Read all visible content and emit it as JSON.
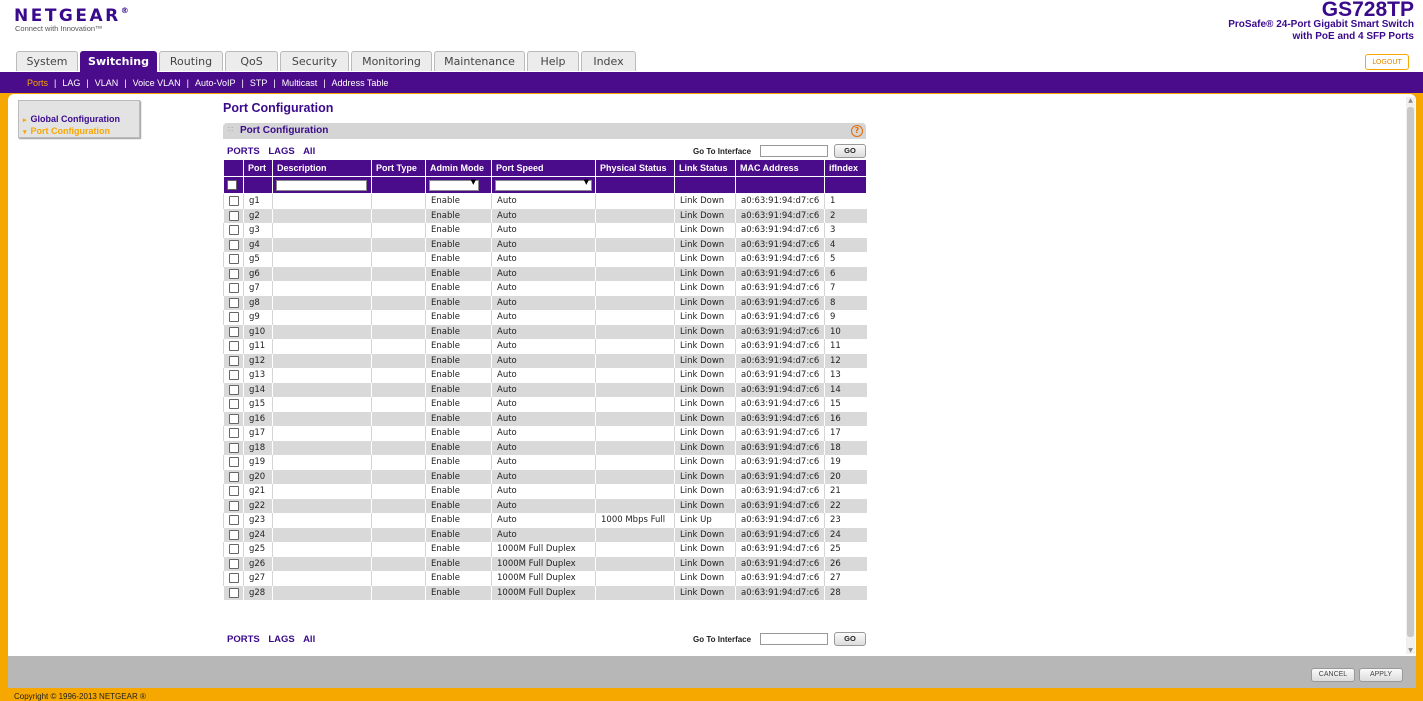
{
  "header": {
    "logo": "NETGEAR",
    "tagline": "Connect with Innovation™",
    "model": "GS728TP",
    "model_desc_line1": "ProSafe® 24-Port Gigabit Smart Switch",
    "model_desc_line2": "with PoE and 4 SFP Ports",
    "logout": "LOGOUT"
  },
  "tabs": [
    "System",
    "Switching",
    "Routing",
    "QoS",
    "Security",
    "Monitoring",
    "Maintenance",
    "Help",
    "Index"
  ],
  "active_tab": "Switching",
  "subnav": [
    "Ports",
    "LAG",
    "VLAN",
    "Voice VLAN",
    "Auto-VoIP",
    "STP",
    "Multicast",
    "Address Table"
  ],
  "active_subnav": "Ports",
  "leftnav": [
    "Global Configuration",
    "Port Configuration"
  ],
  "page_title": "Port Configuration",
  "panel_title": "Port Configuration",
  "help_icon": "?",
  "filter_links": [
    "PORTS",
    "LAGS",
    "All"
  ],
  "goto_label": "Go To Interface",
  "go_button": "GO",
  "table": {
    "columns": [
      "",
      "Port",
      "Description",
      "Port Type",
      "Admin Mode",
      "Port Speed",
      "Physical Status",
      "Link Status",
      "MAC Address",
      "ifIndex"
    ],
    "rows": [
      [
        "g1",
        "",
        "",
        "Enable",
        "Auto",
        "",
        "Link Down",
        "a0:63:91:94:d7:c6",
        "1"
      ],
      [
        "g2",
        "",
        "",
        "Enable",
        "Auto",
        "",
        "Link Down",
        "a0:63:91:94:d7:c6",
        "2"
      ],
      [
        "g3",
        "",
        "",
        "Enable",
        "Auto",
        "",
        "Link Down",
        "a0:63:91:94:d7:c6",
        "3"
      ],
      [
        "g4",
        "",
        "",
        "Enable",
        "Auto",
        "",
        "Link Down",
        "a0:63:91:94:d7:c6",
        "4"
      ],
      [
        "g5",
        "",
        "",
        "Enable",
        "Auto",
        "",
        "Link Down",
        "a0:63:91:94:d7:c6",
        "5"
      ],
      [
        "g6",
        "",
        "",
        "Enable",
        "Auto",
        "",
        "Link Down",
        "a0:63:91:94:d7:c6",
        "6"
      ],
      [
        "g7",
        "",
        "",
        "Enable",
        "Auto",
        "",
        "Link Down",
        "a0:63:91:94:d7:c6",
        "7"
      ],
      [
        "g8",
        "",
        "",
        "Enable",
        "Auto",
        "",
        "Link Down",
        "a0:63:91:94:d7:c6",
        "8"
      ],
      [
        "g9",
        "",
        "",
        "Enable",
        "Auto",
        "",
        "Link Down",
        "a0:63:91:94:d7:c6",
        "9"
      ],
      [
        "g10",
        "",
        "",
        "Enable",
        "Auto",
        "",
        "Link Down",
        "a0:63:91:94:d7:c6",
        "10"
      ],
      [
        "g11",
        "",
        "",
        "Enable",
        "Auto",
        "",
        "Link Down",
        "a0:63:91:94:d7:c6",
        "11"
      ],
      [
        "g12",
        "",
        "",
        "Enable",
        "Auto",
        "",
        "Link Down",
        "a0:63:91:94:d7:c6",
        "12"
      ],
      [
        "g13",
        "",
        "",
        "Enable",
        "Auto",
        "",
        "Link Down",
        "a0:63:91:94:d7:c6",
        "13"
      ],
      [
        "g14",
        "",
        "",
        "Enable",
        "Auto",
        "",
        "Link Down",
        "a0:63:91:94:d7:c6",
        "14"
      ],
      [
        "g15",
        "",
        "",
        "Enable",
        "Auto",
        "",
        "Link Down",
        "a0:63:91:94:d7:c6",
        "15"
      ],
      [
        "g16",
        "",
        "",
        "Enable",
        "Auto",
        "",
        "Link Down",
        "a0:63:91:94:d7:c6",
        "16"
      ],
      [
        "g17",
        "",
        "",
        "Enable",
        "Auto",
        "",
        "Link Down",
        "a0:63:91:94:d7:c6",
        "17"
      ],
      [
        "g18",
        "",
        "",
        "Enable",
        "Auto",
        "",
        "Link Down",
        "a0:63:91:94:d7:c6",
        "18"
      ],
      [
        "g19",
        "",
        "",
        "Enable",
        "Auto",
        "",
        "Link Down",
        "a0:63:91:94:d7:c6",
        "19"
      ],
      [
        "g20",
        "",
        "",
        "Enable",
        "Auto",
        "",
        "Link Down",
        "a0:63:91:94:d7:c6",
        "20"
      ],
      [
        "g21",
        "",
        "",
        "Enable",
        "Auto",
        "",
        "Link Down",
        "a0:63:91:94:d7:c6",
        "21"
      ],
      [
        "g22",
        "",
        "",
        "Enable",
        "Auto",
        "",
        "Link Down",
        "a0:63:91:94:d7:c6",
        "22"
      ],
      [
        "g23",
        "",
        "",
        "Enable",
        "Auto",
        "1000 Mbps Full",
        "Link Up",
        "a0:63:91:94:d7:c6",
        "23"
      ],
      [
        "g24",
        "",
        "",
        "Enable",
        "Auto",
        "",
        "Link Down",
        "a0:63:91:94:d7:c6",
        "24"
      ],
      [
        "g25",
        "",
        "",
        "Enable",
        "1000M Full Duplex",
        "",
        "Link Down",
        "a0:63:91:94:d7:c6",
        "25"
      ],
      [
        "g26",
        "",
        "",
        "Enable",
        "1000M Full Duplex",
        "",
        "Link Down",
        "a0:63:91:94:d7:c6",
        "26"
      ],
      [
        "g27",
        "",
        "",
        "Enable",
        "1000M Full Duplex",
        "",
        "Link Down",
        "a0:63:91:94:d7:c6",
        "27"
      ],
      [
        "g28",
        "",
        "",
        "Enable",
        "1000M Full Duplex",
        "",
        "Link Down",
        "a0:63:91:94:d7:c6",
        "28"
      ]
    ]
  },
  "footer": {
    "cancel": "CANCEL",
    "apply": "APPLY",
    "copyright": "Copyright © 1996-2013 NETGEAR ®"
  },
  "colors": {
    "brand_purple": "#4b0c8b",
    "accent_orange": "#f7a800"
  }
}
